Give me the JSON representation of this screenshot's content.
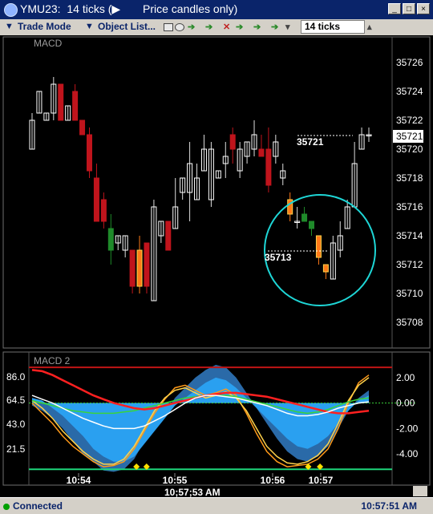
{
  "window": {
    "title": "YMU23:  14 ticks (▶",
    "caption": "Price candles only)",
    "min_glyph": "_",
    "max_glyph": "□",
    "close_glyph": "×"
  },
  "toolbar": {
    "trade_mode": "Trade Mode",
    "object_list": "Object List...",
    "ticks_value": "14 ticks"
  },
  "chart_data": [
    {
      "type": "candlestick",
      "title": "MACD",
      "ylim": [
        35707,
        35727
      ],
      "y_ticks": [
        "35726",
        "35724",
        "35722",
        "35720",
        "35718",
        "35716",
        "35714",
        "35712",
        "35710",
        "35708"
      ],
      "last_price": "35721",
      "annotations": [
        "35721",
        "35713"
      ],
      "candles": [
        {
          "o": 35720.0,
          "h": 35722.5,
          "l": 35720.0,
          "c": 35722.0,
          "color": "white"
        },
        {
          "o": 35722.5,
          "h": 35724.0,
          "l": 35722.5,
          "c": 35724.0,
          "color": "white"
        },
        {
          "o": 35722.0,
          "h": 35722.5,
          "l": 35722.0,
          "c": 35722.5,
          "color": "white"
        },
        {
          "o": 35722.5,
          "h": 35725.0,
          "l": 35722.0,
          "c": 35724.5,
          "color": "white"
        },
        {
          "o": 35724.5,
          "h": 35724.5,
          "l": 35722.0,
          "c": 35722.0,
          "color": "red"
        },
        {
          "o": 35722.0,
          "h": 35723.0,
          "l": 35722.0,
          "c": 35723.0,
          "color": "white"
        },
        {
          "o": 35724.0,
          "h": 35724.5,
          "l": 35722.0,
          "c": 35722.0,
          "color": "red"
        },
        {
          "o": 35722.0,
          "h": 35722.0,
          "l": 35721.0,
          "c": 35721.0,
          "color": "red"
        },
        {
          "o": 35721.0,
          "h": 35721.5,
          "l": 35718.0,
          "c": 35718.5,
          "color": "red"
        },
        {
          "o": 35718.0,
          "h": 35719.0,
          "l": 35715.0,
          "c": 35715.0,
          "color": "red"
        },
        {
          "o": 35716.5,
          "h": 35717.0,
          "l": 35714.5,
          "c": 35715.0,
          "color": "red"
        },
        {
          "o": 35714.5,
          "h": 35715.5,
          "l": 35712.0,
          "c": 35713.0,
          "color": "green"
        },
        {
          "o": 35713.5,
          "h": 35714.0,
          "l": 35713.0,
          "c": 35714.0,
          "color": "white"
        },
        {
          "o": 35714.0,
          "h": 35714.0,
          "l": 35712.5,
          "c": 35713.0,
          "color": "white"
        },
        {
          "o": 35713.0,
          "h": 35713.0,
          "l": 35710.0,
          "c": 35710.5,
          "color": "red"
        },
        {
          "o": 35713.0,
          "h": 35714.0,
          "l": 35710.0,
          "c": 35710.5,
          "color": "orange"
        },
        {
          "o": 35713.5,
          "h": 35713.5,
          "l": 35710.0,
          "c": 35710.5,
          "color": "red"
        },
        {
          "o": 35709.5,
          "h": 35716.5,
          "l": 35709.5,
          "c": 35716.0,
          "color": "white"
        },
        {
          "o": 35714.0,
          "h": 35715.0,
          "l": 35713.5,
          "c": 35715.0,
          "color": "white"
        },
        {
          "o": 35715.0,
          "h": 35715.0,
          "l": 35713.0,
          "c": 35713.0,
          "color": "red"
        },
        {
          "o": 35714.5,
          "h": 35718.0,
          "l": 35714.5,
          "c": 35716.0,
          "color": "white"
        },
        {
          "o": 35717.0,
          "h": 35718.0,
          "l": 35716.5,
          "c": 35718.0,
          "color": "white"
        },
        {
          "o": 35717.0,
          "h": 35720.5,
          "l": 35715.0,
          "c": 35719.0,
          "color": "white"
        },
        {
          "o": 35718.0,
          "h": 35719.0,
          "l": 35716.5,
          "c": 35716.5,
          "color": "white"
        },
        {
          "o": 35718.5,
          "h": 35721.0,
          "l": 35718.5,
          "c": 35720.0,
          "color": "white"
        },
        {
          "o": 35720.0,
          "h": 35720.5,
          "l": 35716.0,
          "c": 35716.5,
          "color": "white"
        },
        {
          "o": 35718.5,
          "h": 35718.5,
          "l": 35718.0,
          "c": 35718.0,
          "color": "white"
        },
        {
          "o": 35719.5,
          "h": 35720.5,
          "l": 35718.0,
          "c": 35719.0,
          "color": "white"
        },
        {
          "o": 35720.0,
          "h": 35721.5,
          "l": 35719.0,
          "c": 35721.0,
          "color": "red"
        },
        {
          "o": 35720.0,
          "h": 35720.5,
          "l": 35718.0,
          "c": 35718.5,
          "color": "white"
        },
        {
          "o": 35720.5,
          "h": 35720.5,
          "l": 35719.0,
          "c": 35719.5,
          "color": "white"
        },
        {
          "o": 35720.0,
          "h": 35722.0,
          "l": 35719.5,
          "c": 35721.0,
          "color": "white"
        },
        {
          "o": 35719.5,
          "h": 35721.0,
          "l": 35719.5,
          "c": 35720.0,
          "color": "red"
        },
        {
          "o": 35720.0,
          "h": 35721.5,
          "l": 35717.0,
          "c": 35717.5,
          "color": "red"
        },
        {
          "o": 35719.5,
          "h": 35721.0,
          "l": 35719.0,
          "c": 35720.5,
          "color": "white"
        },
        {
          "o": 35718.5,
          "h": 35719.0,
          "l": 35717.5,
          "c": 35718.0,
          "color": "white"
        },
        {
          "o": 35716.5,
          "h": 35717.0,
          "l": 35715.0,
          "c": 35715.5,
          "color": "orange"
        },
        {
          "o": 35715.0,
          "h": 35716.0,
          "l": 35714.5,
          "c": 35715.0,
          "color": "white"
        },
        {
          "o": 35715.5,
          "h": 35716.0,
          "l": 35715.0,
          "c": 35715.0,
          "color": "green"
        },
        {
          "o": 35715.0,
          "h": 35715.0,
          "l": 35714.0,
          "c": 35714.5,
          "color": "green"
        },
        {
          "o": 35714.0,
          "h": 35714.0,
          "l": 35712.0,
          "c": 35712.5,
          "color": "orange"
        },
        {
          "o": 35712.0,
          "h": 35712.0,
          "l": 35711.0,
          "c": 35711.5,
          "color": "orange"
        },
        {
          "o": 35711.0,
          "h": 35714.0,
          "l": 35711.0,
          "c": 35713.5,
          "color": "white"
        },
        {
          "o": 35713.0,
          "h": 35715.0,
          "l": 35712.5,
          "c": 35714.0,
          "color": "white"
        },
        {
          "o": 35714.5,
          "h": 35716.5,
          "l": 35714.5,
          "c": 35716.0,
          "color": "white"
        },
        {
          "o": 35716.0,
          "h": 35720.5,
          "l": 35716.0,
          "c": 35719.0,
          "color": "white"
        },
        {
          "o": 35720.0,
          "h": 35721.5,
          "l": 35720.0,
          "c": 35721.0,
          "color": "white"
        },
        {
          "o": 35721.0,
          "h": 35721.5,
          "l": 35720.5,
          "c": 35721.0,
          "color": "white"
        }
      ]
    },
    {
      "type": "line",
      "title": "MACD 2",
      "y_ticks_left": [
        "86.0",
        "64.5",
        "43.0",
        "21.5"
      ],
      "y_ticks_right": [
        "2.00",
        "0.00",
        "-2.00",
        "-4.00"
      ],
      "x_ticks": [
        "10:54",
        "10:55",
        "10:56",
        "10:57"
      ],
      "ylim": [
        -5.5,
        3
      ],
      "series": [
        {
          "color": "#2a6aa8",
          "values": [
            -0.2,
            -0.6,
            -1.2,
            -2.0,
            -3.0,
            -4.0,
            -4.6,
            -5.3,
            -5.4,
            -5.2,
            -4.4,
            -3.0,
            -1.8,
            -0.8,
            0.4,
            1.2,
            2.0,
            2.6,
            3.0,
            2.8,
            2.0,
            0.8,
            -0.4,
            -1.6,
            -2.8,
            -3.8,
            -4.4,
            -4.6,
            -4.2,
            -3.4,
            -2.0,
            -0.6,
            0.4,
            1.0
          ]
        },
        {
          "color": "#2aa0f0",
          "values": [
            0.4,
            0.2,
            -0.4,
            -1.0,
            -1.8,
            -2.6,
            -3.6,
            -4.2,
            -4.6,
            -4.6,
            -4.2,
            -3.2,
            -2.2,
            -1.2,
            -0.2,
            0.4,
            1.0,
            1.6,
            2.0,
            1.8,
            1.2,
            0.4,
            -0.4,
            -1.2,
            -2.0,
            -2.8,
            -3.4,
            -3.6,
            -3.2,
            -2.6,
            -1.6,
            -0.6,
            0.2,
            0.6
          ]
        },
        {
          "color": "#ff9a1a",
          "values": [
            0.0,
            -0.8,
            -1.6,
            -2.6,
            -3.4,
            -4.0,
            -4.6,
            -5.0,
            -4.9,
            -4.6,
            -3.6,
            -2.2,
            -0.8,
            0.3,
            1.2,
            1.4,
            1.0,
            0.6,
            0.8,
            1.1,
            0.6,
            -0.8,
            -2.4,
            -3.8,
            -4.6,
            -5.0,
            -4.9,
            -4.8,
            -4.4,
            -3.6,
            -2.0,
            0.0,
            1.6,
            2.2
          ]
        },
        {
          "color": "#ffd24a",
          "values": [
            0.2,
            -0.4,
            -1.2,
            -2.2,
            -3.0,
            -3.8,
            -4.4,
            -4.8,
            -4.8,
            -4.4,
            -3.4,
            -2.0,
            -0.6,
            0.4,
            1.0,
            1.2,
            0.8,
            0.4,
            0.6,
            0.9,
            0.4,
            -0.6,
            -2.0,
            -3.4,
            -4.2,
            -4.7,
            -4.8,
            -4.6,
            -4.1,
            -3.2,
            -1.6,
            0.2,
            1.4,
            2.0
          ]
        },
        {
          "color": "#3ad43a",
          "values": [
            0.2,
            0.0,
            -0.2,
            -0.4,
            -0.6,
            -0.7,
            -0.8,
            -0.8,
            -0.8,
            -0.7,
            -0.6,
            -0.4,
            -0.2,
            0.0,
            0.2,
            0.4,
            0.5,
            0.6,
            0.6,
            0.6,
            0.5,
            0.3,
            0.1,
            -0.1,
            -0.3,
            -0.5,
            -0.7,
            -0.8,
            -0.7,
            -0.5,
            -0.2,
            0.1,
            0.3,
            0.4
          ]
        },
        {
          "color": "#ff2020",
          "values": [
            2.6,
            2.5,
            2.2,
            1.8,
            1.4,
            1.0,
            0.6,
            0.3,
            0.0,
            -0.2,
            -0.4,
            -0.5,
            -0.4,
            -0.2,
            0.0,
            0.2,
            0.4,
            0.6,
            0.7,
            0.8,
            0.8,
            0.7,
            0.6,
            0.5,
            0.3,
            0.1,
            -0.1,
            -0.3,
            -0.5,
            -0.7,
            -0.8,
            -0.8,
            -0.7,
            -0.6
          ]
        },
        {
          "color": "#ffffff",
          "values": [
            0.6,
            0.3,
            0.0,
            -0.4,
            -0.8,
            -1.2,
            -1.5,
            -1.8,
            -2.0,
            -2.0,
            -2.0,
            -1.8,
            -1.4,
            -1.0,
            -0.5,
            0.0,
            0.4,
            0.6,
            0.6,
            0.5,
            0.4,
            0.2,
            0.0,
            -0.2,
            -0.5,
            -0.8,
            -1.0,
            -1.0,
            -0.9,
            -0.7,
            -0.4,
            -0.2,
            0.0,
            0.1
          ]
        }
      ],
      "levels": {
        "upper": 2.8,
        "zero": 0.0,
        "lower": -5.2
      },
      "markers": [
        "10:55",
        "10:57"
      ]
    }
  ],
  "chart_time": "10;57;53  AM",
  "status": {
    "connected": "Connected",
    "time": "10:57:51 AM"
  }
}
